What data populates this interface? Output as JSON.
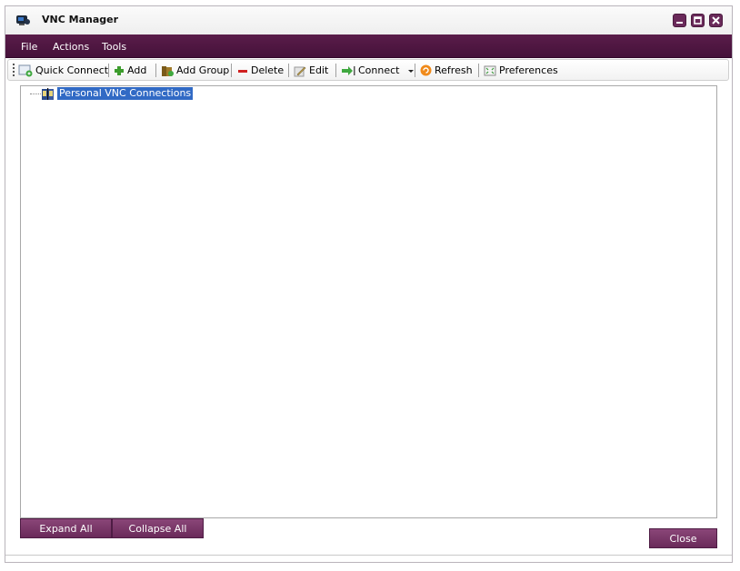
{
  "window": {
    "title": "VNC Manager",
    "app_icon": "vnc-app-icon",
    "controls": [
      "minimize-icon",
      "maximize-icon",
      "close-icon"
    ],
    "accent_color": "#5a1d4a"
  },
  "menu": {
    "items": [
      "File",
      "Actions",
      "Tools"
    ]
  },
  "toolbar": {
    "quick_connect": "Quick Connect",
    "add": "Add",
    "add_group": "Add Group",
    "delete": "Delete",
    "edit": "Edit",
    "connect": "Connect",
    "refresh": "Refresh",
    "preferences": "Preferences"
  },
  "tree": {
    "root_label": "Personal VNC Connections",
    "selection_color": "#316ac5"
  },
  "buttons": {
    "expand_all": "Expand All",
    "collapse_all": "Collapse All",
    "close": "Close"
  }
}
